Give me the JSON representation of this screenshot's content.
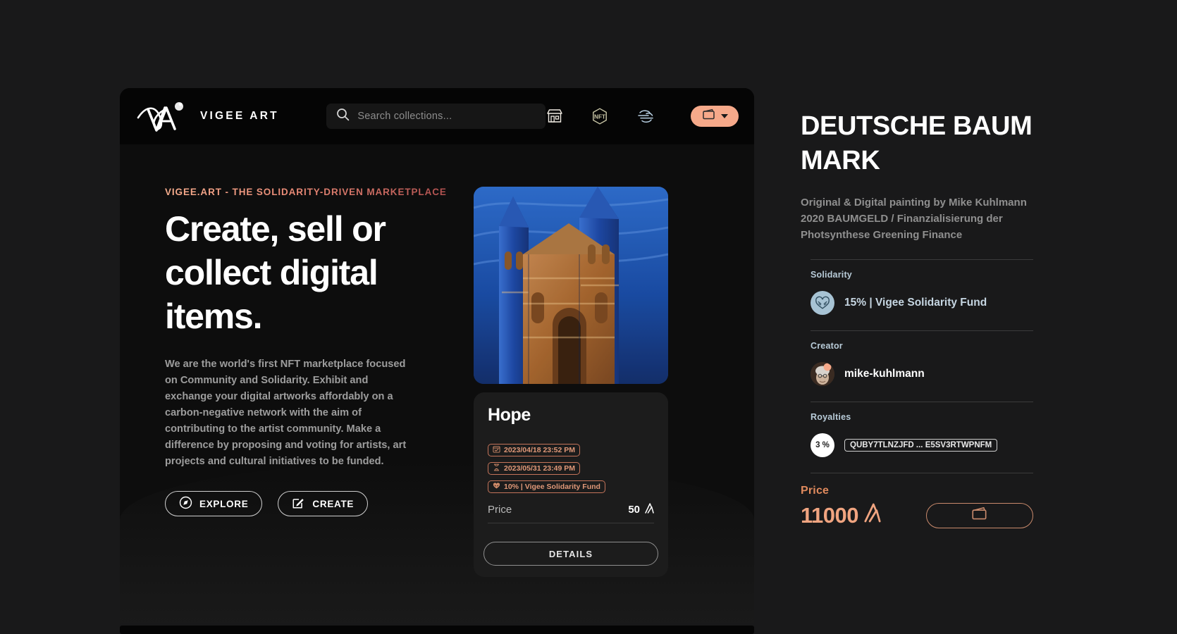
{
  "nav": {
    "brand_name": "VIGEE ART",
    "logo_icon": "vigee-monogram-logo",
    "search_placeholder": "Search collections...",
    "search_value": "",
    "search_icon": "search-icon",
    "icons": [
      {
        "name": "marketplace-icon",
        "label": "Marketplace"
      },
      {
        "name": "nft-icon",
        "label": "NFT"
      },
      {
        "name": "activity-icon",
        "label": "Activity"
      }
    ],
    "wallet_button": {
      "icon": "wallet-icon",
      "caret": "chevron-down-icon"
    }
  },
  "hero": {
    "eyebrow": "VIGEE.ART - THE SOLIDARITY-DRIVEN MARKETPLACE",
    "headline": "Create, sell or collect digital items.",
    "lede": "We are the world's first NFT marketplace focused on Community and Solidarity. Exhibit and exchange your digital artworks affordably on a carbon-negative network with the aim of contributing to the artist community. Make a difference by proposing and voting for artists, art projects and cultural initiatives to be funded.",
    "explore_label": "EXPLORE",
    "explore_icon": "compass-icon",
    "create_label": "CREATE",
    "create_icon": "pencil-square-icon"
  },
  "featured_card": {
    "artwork_alt": "Blue and orange expressionist painting of a gothic church facade",
    "title": "Hope",
    "chips": [
      {
        "icon": "calendar-check-icon",
        "text": "2023/04/18 23:52 PM"
      },
      {
        "icon": "hourglass-icon",
        "text": "2023/05/31 23:49 PM"
      },
      {
        "icon": "heart-hands-icon",
        "text": "10% | Vigee Solidarity Fund"
      }
    ],
    "price_label": "Price",
    "price_value": "50",
    "currency_icon": "algo-currency-icon",
    "details_label": "DETAILS"
  },
  "detail_panel": {
    "title": "DEUTSCHE BAUM MARK",
    "description": "Original & Digital painting by Mike Kuhlmann 2020 BAUMGELD / Finanzialisierung der Photsynthese Greening Finance",
    "solidarity": {
      "label": "Solidarity",
      "icon": "heart-hands-icon",
      "value": "15% | Vigee Solidarity Fund"
    },
    "creator": {
      "label": "Creator",
      "avatar_icon": "creator-avatar",
      "name": "mike-kuhlmann"
    },
    "royalties": {
      "label": "Royalties",
      "percent": "3 %",
      "address": "QUBY7TLNZJFD ... E5SV3RTWPNFM"
    },
    "price": {
      "label": "Price",
      "value": "11000",
      "currency_icon": "algo-currency-icon",
      "buy_icon": "wallet-icon"
    }
  },
  "colors": {
    "accent": "#f0a480",
    "chip_border": "#c4745a",
    "page_bg": "#19191a",
    "panel_bg": "#1c1c1c",
    "solidarity_blue": "#a7c3d4"
  }
}
